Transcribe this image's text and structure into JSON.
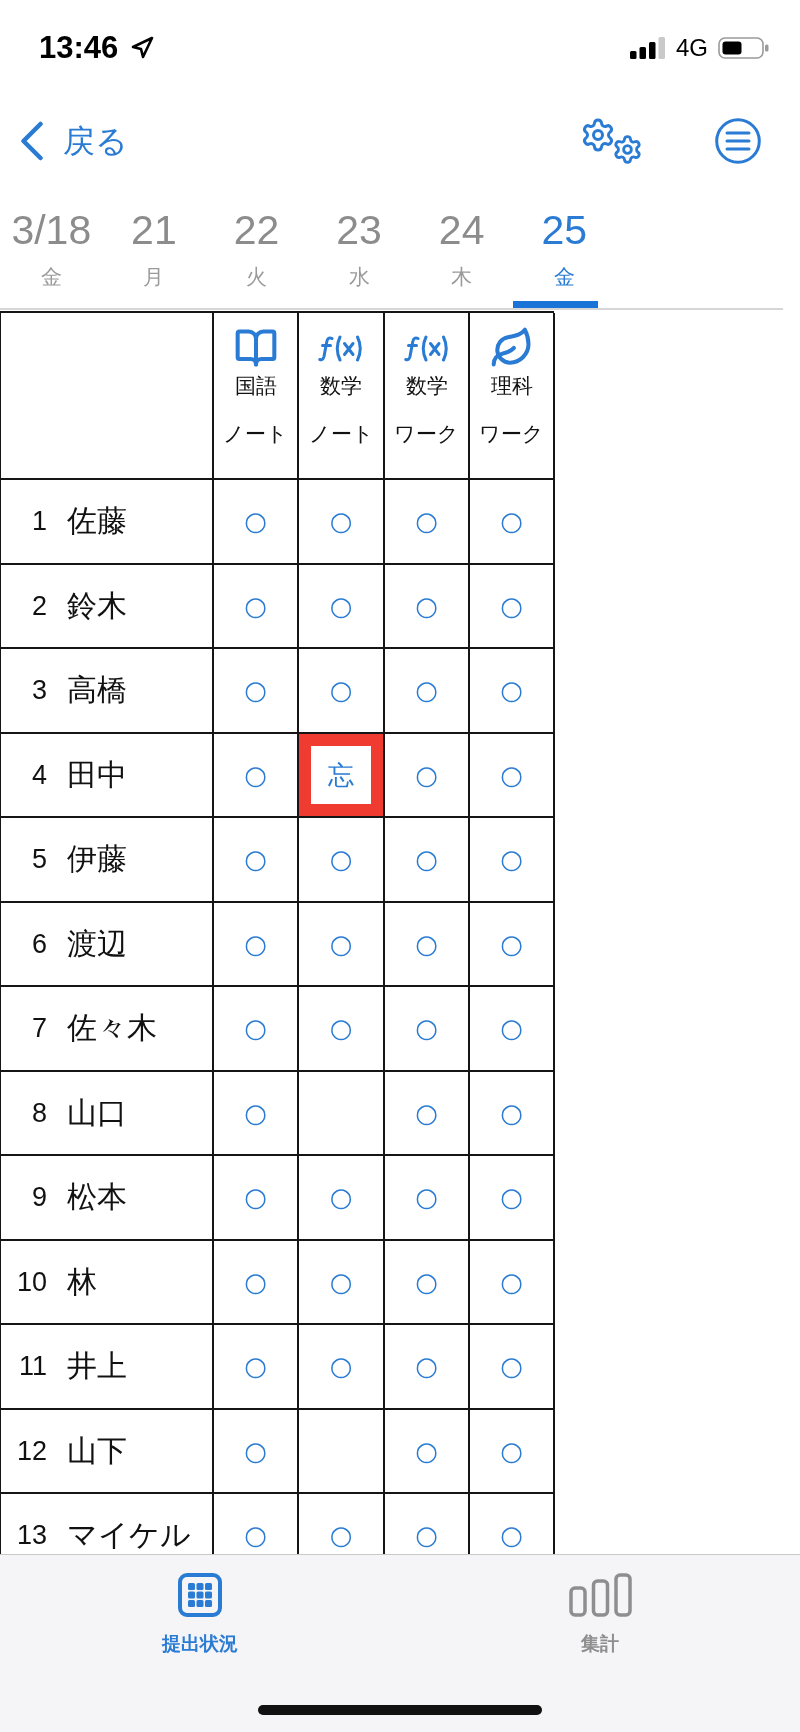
{
  "status_bar": {
    "time": "13:46",
    "network": "4G"
  },
  "nav": {
    "back_label": "戻る"
  },
  "date_tabs": [
    {
      "date": "3/18",
      "weekday": "金",
      "selected": false
    },
    {
      "date": "21",
      "weekday": "月",
      "selected": false
    },
    {
      "date": "22",
      "weekday": "火",
      "selected": false
    },
    {
      "date": "23",
      "weekday": "水",
      "selected": false
    },
    {
      "date": "24",
      "weekday": "木",
      "selected": false
    },
    {
      "date": "25",
      "weekday": "金",
      "selected": true
    }
  ],
  "columns": [
    {
      "kind": "book",
      "subject": "国語",
      "type": "ノート"
    },
    {
      "kind": "function",
      "subject": "数学",
      "type": "ノート"
    },
    {
      "kind": "function",
      "subject": "数学",
      "type": "ワーク"
    },
    {
      "kind": "leaf",
      "subject": "理科",
      "type": "ワーク"
    }
  ],
  "students": [
    {
      "number": "1",
      "name": "佐藤",
      "cells": [
        {
          "mark": "○",
          "highlighted": false
        },
        {
          "mark": "○",
          "highlighted": false
        },
        {
          "mark": "○",
          "highlighted": false
        },
        {
          "mark": "○",
          "highlighted": false
        }
      ]
    },
    {
      "number": "2",
      "name": "鈴木",
      "cells": [
        {
          "mark": "○",
          "highlighted": false
        },
        {
          "mark": "○",
          "highlighted": false
        },
        {
          "mark": "○",
          "highlighted": false
        },
        {
          "mark": "○",
          "highlighted": false
        }
      ]
    },
    {
      "number": "3",
      "name": "高橋",
      "cells": [
        {
          "mark": "○",
          "highlighted": false
        },
        {
          "mark": "○",
          "highlighted": false
        },
        {
          "mark": "○",
          "highlighted": false
        },
        {
          "mark": "○",
          "highlighted": false
        }
      ]
    },
    {
      "number": "4",
      "name": "田中",
      "cells": [
        {
          "mark": "○",
          "highlighted": false
        },
        {
          "mark": "忘",
          "highlighted": true
        },
        {
          "mark": "○",
          "highlighted": false
        },
        {
          "mark": "○",
          "highlighted": false
        }
      ]
    },
    {
      "number": "5",
      "name": "伊藤",
      "cells": [
        {
          "mark": "○",
          "highlighted": false
        },
        {
          "mark": "○",
          "highlighted": false
        },
        {
          "mark": "○",
          "highlighted": false
        },
        {
          "mark": "○",
          "highlighted": false
        }
      ]
    },
    {
      "number": "6",
      "name": "渡辺",
      "cells": [
        {
          "mark": "○",
          "highlighted": false
        },
        {
          "mark": "○",
          "highlighted": false
        },
        {
          "mark": "○",
          "highlighted": false
        },
        {
          "mark": "○",
          "highlighted": false
        }
      ]
    },
    {
      "number": "7",
      "name": "佐々木",
      "cells": [
        {
          "mark": "○",
          "highlighted": false
        },
        {
          "mark": "○",
          "highlighted": false
        },
        {
          "mark": "○",
          "highlighted": false
        },
        {
          "mark": "○",
          "highlighted": false
        }
      ]
    },
    {
      "number": "8",
      "name": "山口",
      "cells": [
        {
          "mark": "○",
          "highlighted": false
        },
        {
          "highlighted": false
        },
        {
          "mark": "○",
          "highlighted": false
        },
        {
          "mark": "○",
          "highlighted": false
        }
      ]
    },
    {
      "number": "9",
      "name": "松本",
      "cells": [
        {
          "mark": "○",
          "highlighted": false
        },
        {
          "mark": "○",
          "highlighted": false
        },
        {
          "mark": "○",
          "highlighted": false
        },
        {
          "mark": "○",
          "highlighted": false
        }
      ]
    },
    {
      "number": "10",
      "name": "林",
      "cells": [
        {
          "mark": "○",
          "highlighted": false
        },
        {
          "mark": "○",
          "highlighted": false
        },
        {
          "mark": "○",
          "highlighted": false
        },
        {
          "mark": "○",
          "highlighted": false
        }
      ]
    },
    {
      "number": "11",
      "name": "井上",
      "cells": [
        {
          "mark": "○",
          "highlighted": false
        },
        {
          "mark": "○",
          "highlighted": false
        },
        {
          "mark": "○",
          "highlighted": false
        },
        {
          "mark": "○",
          "highlighted": false
        }
      ]
    },
    {
      "number": "12",
      "name": "山下",
      "cells": [
        {
          "mark": "○",
          "highlighted": false
        },
        {
          "highlighted": false
        },
        {
          "mark": "○",
          "highlighted": false
        },
        {
          "mark": "○",
          "highlighted": false
        }
      ]
    },
    {
      "number": "13",
      "name": "マイケル",
      "cells": [
        {
          "mark": "○",
          "highlighted": false
        },
        {
          "mark": "○",
          "highlighted": false
        },
        {
          "mark": "○",
          "highlighted": false
        },
        {
          "mark": "○",
          "highlighted": false
        }
      ]
    }
  ],
  "tab_bar": [
    {
      "kind": "grid",
      "label": "提出状況",
      "selected": true
    },
    {
      "kind": "bars",
      "label": "集計",
      "selected": false
    }
  ]
}
